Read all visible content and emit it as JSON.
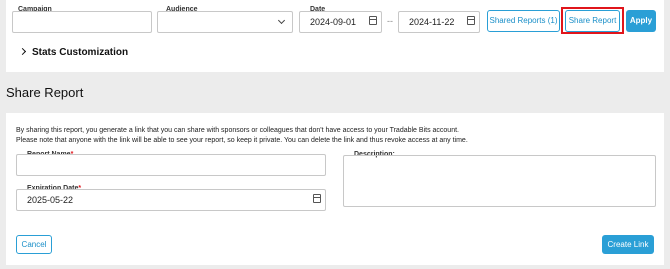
{
  "filters": {
    "campaign_label": "Campaign",
    "campaign_value": "",
    "audience_label": "Audience",
    "audience_value": "",
    "date_label": "Date",
    "date_from": "2024-09-01",
    "date_separator": "--",
    "date_to": "2024-11-22",
    "shared_reports_label": "Shared Reports (1)",
    "share_report_label": "Share Report",
    "apply_label": "Apply"
  },
  "stats_customization": {
    "label": "Stats Customization"
  },
  "share_report": {
    "title": "Share Report",
    "description_line1": "By sharing this report, you generate a link that you can share with sponsors or colleagues that don't have access to your Tradable Bits account.",
    "description_line2": "Please note that anyone with the link will be able to see your report, so keep it private. You can delete the link and thus revoke access at any time.",
    "report_name_label": "Report Name",
    "report_name_value": "",
    "required_marker": "*",
    "expiration_label": "Expiration Date",
    "expiration_value": "2025-05-22",
    "description_label": "Description:",
    "description_value": "",
    "cancel_label": "Cancel",
    "create_link_label": "Create Link"
  },
  "colors": {
    "accent": "#2a9fd6",
    "highlight": "#e0151b",
    "required": "#e0151b"
  },
  "icons": {
    "calendar": "calendar-icon",
    "chevron": "chevron-down-icon",
    "caret": "chevron-right-icon"
  }
}
